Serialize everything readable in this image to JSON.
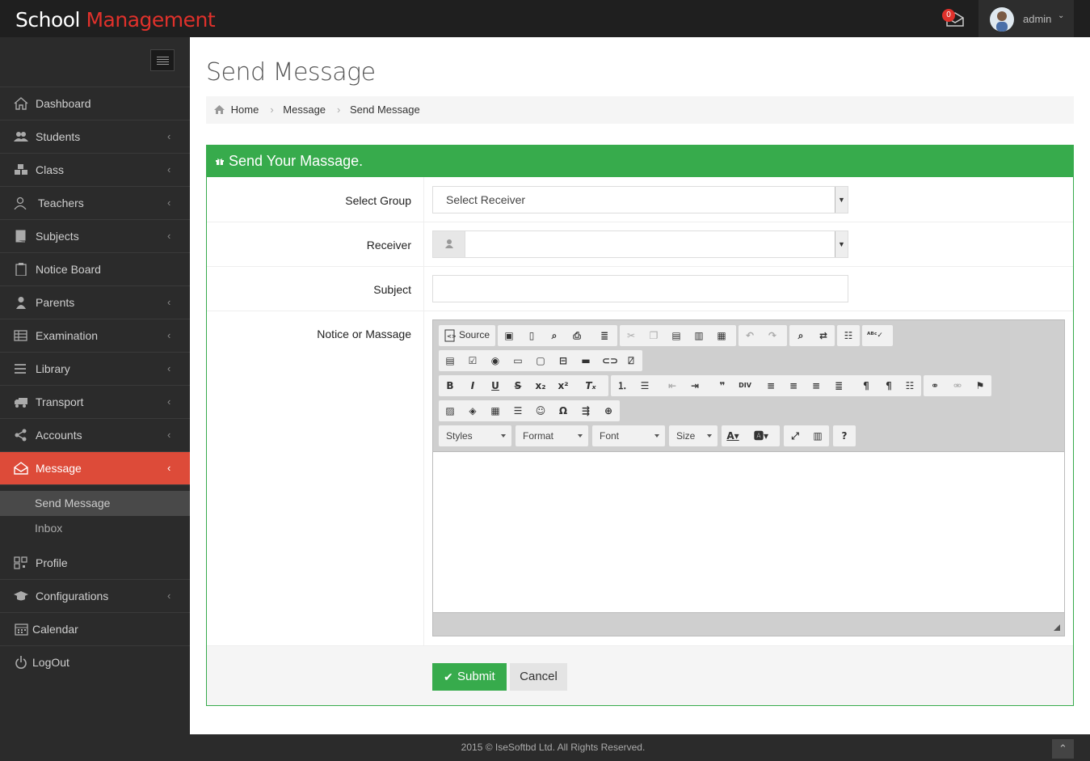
{
  "brand": {
    "part1": "School ",
    "part2": "Management"
  },
  "header": {
    "mail_count": "0",
    "user": "admin"
  },
  "nav": [
    {
      "label": "Dashboard",
      "icon": "home-icon",
      "chevron": false
    },
    {
      "label": "Students",
      "icon": "users-icon",
      "chevron": true
    },
    {
      "label": "Class",
      "icon": "cubes-icon",
      "chevron": true
    },
    {
      "label": "Teachers",
      "icon": "teacher-icon",
      "chevron": true
    },
    {
      "label": "Subjects",
      "icon": "book-icon",
      "chevron": true
    },
    {
      "label": "Notice Board",
      "icon": "clipboard-icon",
      "chevron": false
    },
    {
      "label": "Parents",
      "icon": "user-icon",
      "chevron": true
    },
    {
      "label": "Examination",
      "icon": "table-icon",
      "chevron": true
    },
    {
      "label": "Library",
      "icon": "list-icon",
      "chevron": true
    },
    {
      "label": "Transport",
      "icon": "truck-icon",
      "chevron": true
    },
    {
      "label": "Accounts",
      "icon": "share-icon",
      "chevron": true
    },
    {
      "label": "Message",
      "icon": "envelope-open-icon",
      "chevron": true,
      "active": true
    }
  ],
  "sub_nav": [
    {
      "label": "Send Message",
      "selected": true
    },
    {
      "label": "Inbox"
    }
  ],
  "nav2": [
    {
      "label": "Profile",
      "icon": "qrcode-icon",
      "chevron": false
    },
    {
      "label": "Configurations",
      "icon": "graduation-cap-icon",
      "chevron": true
    },
    {
      "label": "Calendar",
      "icon": "calendar-icon",
      "chevron": false
    },
    {
      "label": "LogOut",
      "icon": "power-icon",
      "chevron": false
    }
  ],
  "page": {
    "title": "Send Message"
  },
  "breadcrumb": [
    "Home",
    "Message",
    "Send Message"
  ],
  "panel": {
    "title": "Send Your Massage."
  },
  "form": {
    "group_label": "Select Group",
    "group_value": "Select Receiver",
    "receiver_label": "Receiver",
    "receiver_value": "",
    "subject_label": "Subject",
    "subject_value": "",
    "notice_label": "Notice or Massage"
  },
  "editor": {
    "source_label": "Source",
    "combos": [
      "Styles",
      "Format",
      "Font",
      "Size"
    ]
  },
  "buttons": {
    "submit": "Submit",
    "cancel": "Cancel"
  },
  "footer": {
    "text": "2015 © IseSoftbd Ltd. All Rights Reserved."
  },
  "colors": {
    "brand_red": "#e0312b",
    "active_nav": "#dd4b39",
    "panel_green": "#37ab4c"
  }
}
